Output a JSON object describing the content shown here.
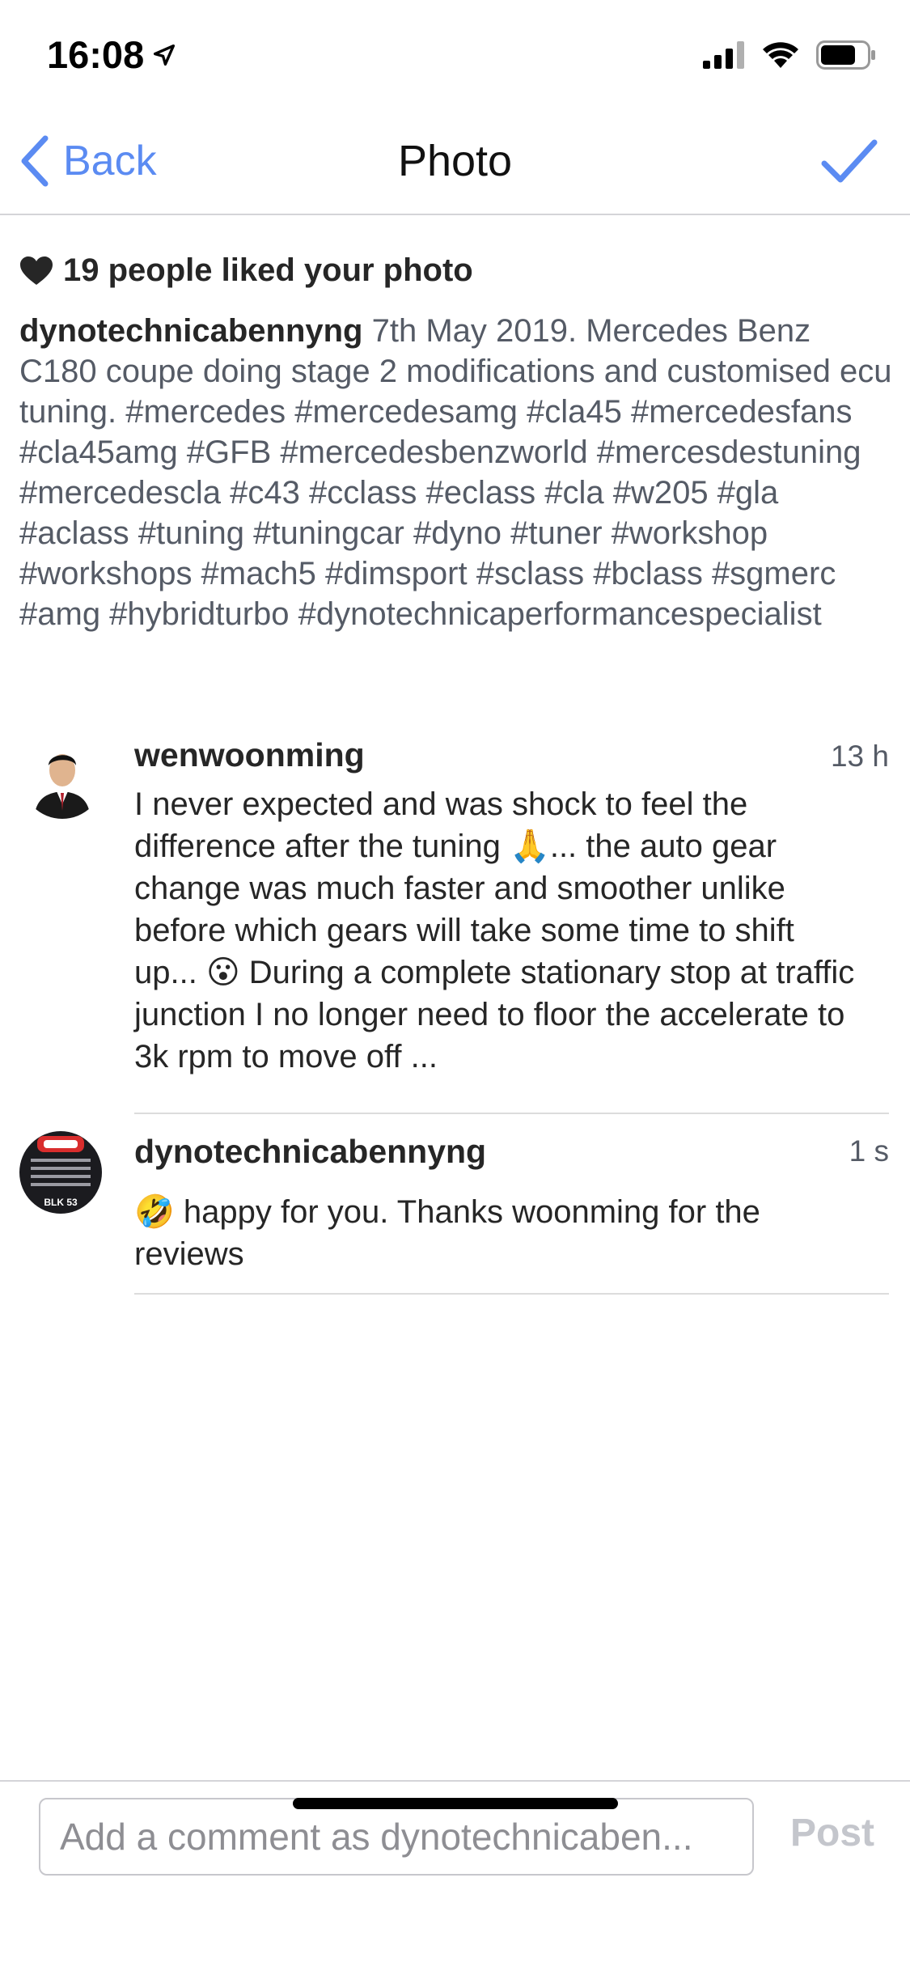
{
  "status_bar": {
    "time": "16:08"
  },
  "nav": {
    "back_label": "Back",
    "title": "Photo"
  },
  "likes": {
    "text": "19 people liked your photo"
  },
  "caption": {
    "username": "dynotechnicabennyng",
    "text": "7th May 2019. Mercedes Benz C180 coupe doing stage 2 modifications and customised ecu tuning. #mercedes #mercedesamg #cla45 #mercedesfans #cla45amg #GFB #mercedesbenzworld #mercesdestuning #mercedescla #c43 #cclass #eclass #cla #w205 #gla #aclass #tuning #tuningcar #dyno #tuner #workshop #workshops #mach5 #dimsport #sclass #bclass #sgmerc #amg #hybridturbo #dynotechnicaperformancespecialist"
  },
  "comments": [
    {
      "username": "wenwoonming",
      "time": "13 h",
      "text": "I never expected and was shock to feel the difference after the tuning 🙏... the auto gear change was much faster and smoother unlike before which gears will take some time to shift up... 😮 During a complete stationary stop at traffic junction I no longer need to floor the accelerate to 3k rpm to move off ..."
    },
    {
      "username": "dynotechnicabennyng",
      "time": "1 s",
      "text": "🤣 happy for you. Thanks woonming for the reviews",
      "avatar_text": "BLK 53"
    }
  ],
  "composer": {
    "placeholder": "Add a comment as dynotechnicaben...",
    "post_label": "Post"
  },
  "colors": {
    "accent": "#5b8bf2",
    "text": "#262626",
    "muted": "#555b66",
    "post_disabled": "#c4c6cc"
  },
  "icons": [
    "location-arrow-icon",
    "signal-icon",
    "wifi-icon",
    "battery-icon",
    "chevron-left-icon",
    "checkmark-icon",
    "heart-icon"
  ]
}
